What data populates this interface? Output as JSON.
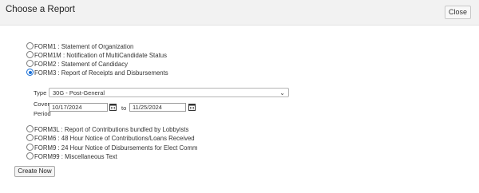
{
  "dialog": {
    "title": "Choose a Report",
    "close_label": "Close"
  },
  "reports_top": [
    {
      "label": "FORM1 : Statement of Organization",
      "checked": false
    },
    {
      "label": "FORM1M : Notification of MultiCandidate Status",
      "checked": false
    },
    {
      "label": "FORM2 : Statement of Candidacy",
      "checked": false
    },
    {
      "label": "FORM3 : Report of Receipts and Disbursements",
      "checked": true
    }
  ],
  "options": {
    "type_label": "Type",
    "type_value": "30G - Post-General",
    "cover_label_line1": "Cover",
    "cover_label_line2": "Period",
    "from_date": "10/17/2024",
    "to_label": "to",
    "to_date": "11/25/2024"
  },
  "reports_bottom": [
    {
      "label": "FORM3L : Report of Contributions bundled by Lobbyists",
      "checked": false
    },
    {
      "label": "FORM6 : 48 Hour Notice of Contributions/Loans Received",
      "checked": false
    },
    {
      "label": "FORM9 : 24 Hour Notice of Disbursements for Elect Comm",
      "checked": false
    },
    {
      "label": "FORM99 : Miscellaneous Text",
      "checked": false
    }
  ],
  "create_label": "Create Now",
  "colors": {
    "accent": "#1a6fd6",
    "header_bg": "#f2f2f2"
  }
}
